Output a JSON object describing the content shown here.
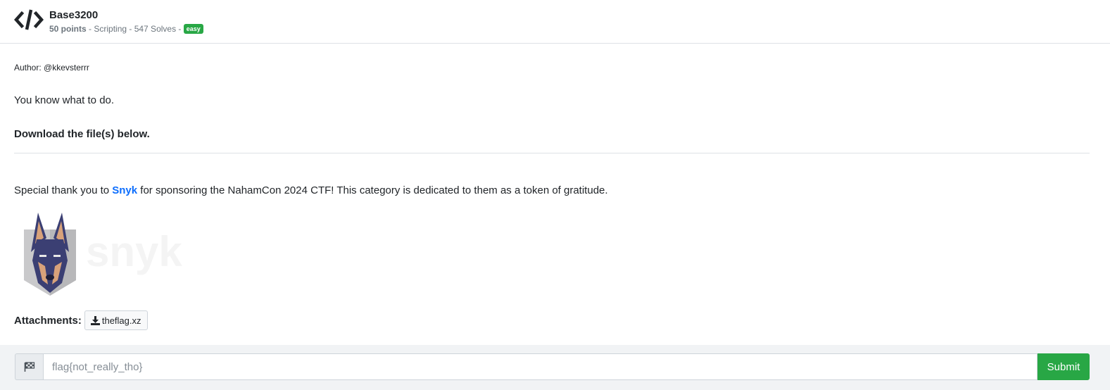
{
  "challenge": {
    "title": "Base3200",
    "points": "50 points",
    "category_text": " - Scripting - 547 Solves - ",
    "difficulty": "easy",
    "icon": "code-icon"
  },
  "description": {
    "author": "Author: @kkevsterrr",
    "text": "You know what to do.",
    "download_note": "Download the file(s) below."
  },
  "sponsor": {
    "before": "Special thank you to ",
    "link": "Snyk",
    "after": " for sponsoring the NahamCon 2024 CTF! This category is dedicated to them as a token of gratitude.",
    "logo_text": "snyk"
  },
  "attachments": {
    "label": "Attachments:",
    "files": [
      {
        "name": "theflag.xz",
        "icon": "download-icon"
      }
    ]
  },
  "flag_form": {
    "icon": "flag-icon",
    "placeholder": "flag{not_really_tho}",
    "submit_label": "Submit"
  },
  "colors": {
    "accent_green": "#28a745",
    "link_blue": "#0d6efd"
  }
}
